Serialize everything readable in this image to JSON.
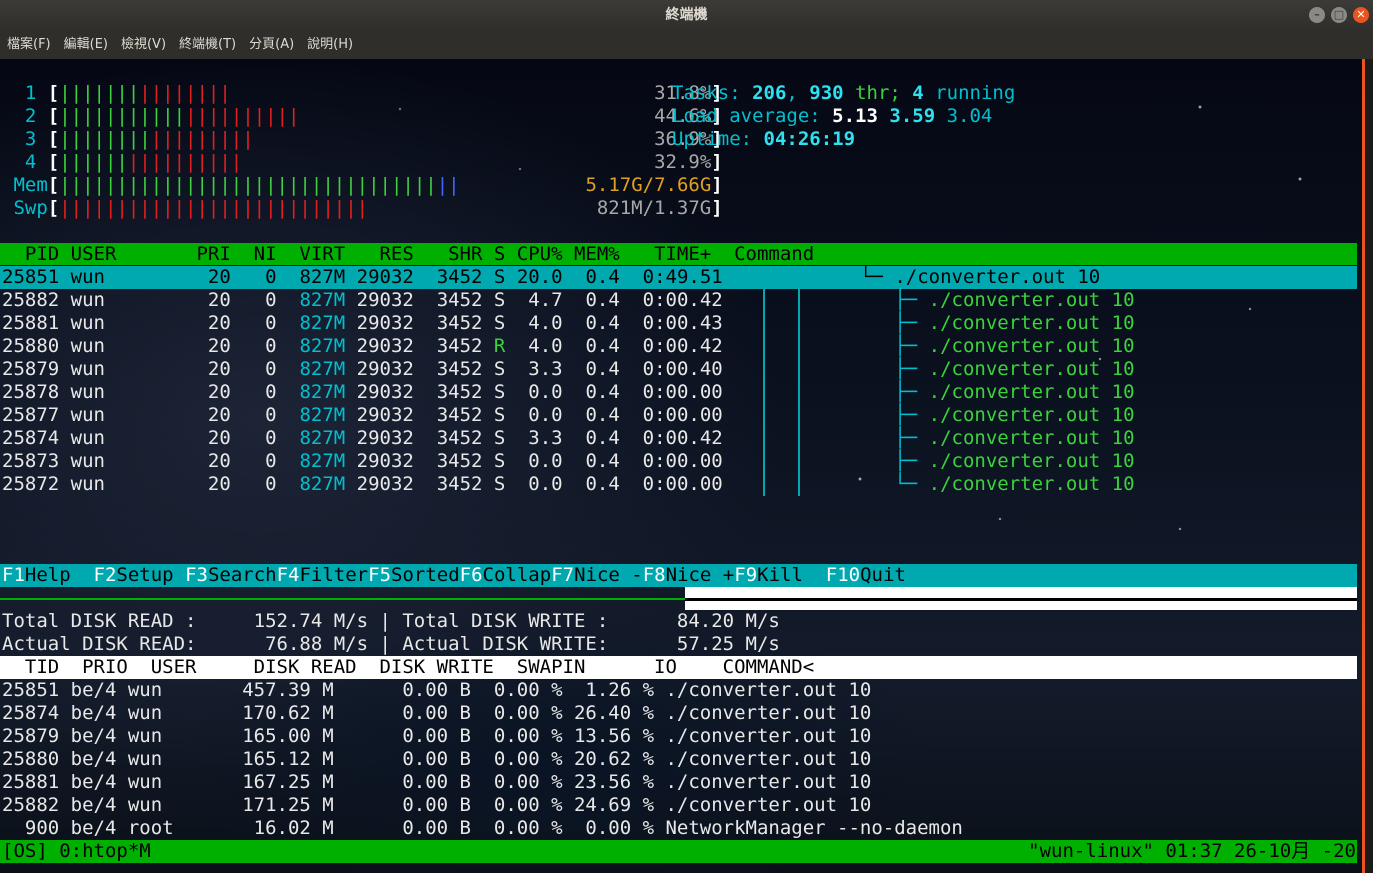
{
  "window": {
    "title": "終端機"
  },
  "menubar": [
    "檔案(F)",
    "編輯(E)",
    "檢視(V)",
    "終端機(T)",
    "分頁(A)",
    "說明(H)"
  ],
  "meters": {
    "cpu": [
      {
        "id": "1",
        "green": 7,
        "red": 8,
        "percent": "31.8%"
      },
      {
        "id": "2",
        "green": 11,
        "red": 10,
        "percent": "44.6%"
      },
      {
        "id": "3",
        "green": 8,
        "red": 9,
        "percent": "36.9%"
      },
      {
        "id": "4",
        "green": 6,
        "red": 10,
        "percent": "32.9%"
      }
    ],
    "mem": {
      "label": "Mem",
      "green": 33,
      "blue": 2,
      "text": "5.17G/7.66G"
    },
    "swp": {
      "label": "Swp",
      "red": 27,
      "text": "821M/1.37G"
    }
  },
  "summary": {
    "tasks_label": "Tasks: ",
    "tasks": "206",
    "threads": "930",
    "thr_label": "thr; ",
    "running": "4",
    "running_label": "running",
    "load_label": "Load average: ",
    "load1": "5.13",
    "load5": "3.59",
    "load15": "3.04",
    "uptime_label": "Uptime: ",
    "uptime": "04:26:19"
  },
  "htop_header": "  PID USER       PRI  NI  VIRT   RES   SHR S CPU% MEM%   TIME+  Command",
  "processes": [
    {
      "pid": "25851",
      "user": "wun",
      "pri": "20",
      "ni": "0",
      "virt": "827M",
      "res": "29032",
      "shr": "3452",
      "s": "S",
      "cpu": "20.0",
      "mem": "0.4",
      "time": "0:49.51",
      "tree": "└─",
      "cmd": "./converter.out 10",
      "selected": true
    },
    {
      "pid": "25882",
      "user": "wun",
      "pri": "20",
      "ni": "0",
      "virt": "827M",
      "res": "29032",
      "shr": "3452",
      "s": "S",
      "cpu": "4.7",
      "mem": "0.4",
      "time": "0:00.42",
      "tree": "├─",
      "cmd": "./converter.out 10"
    },
    {
      "pid": "25881",
      "user": "wun",
      "pri": "20",
      "ni": "0",
      "virt": "827M",
      "res": "29032",
      "shr": "3452",
      "s": "S",
      "cpu": "4.0",
      "mem": "0.4",
      "time": "0:00.43",
      "tree": "├─",
      "cmd": "./converter.out 10"
    },
    {
      "pid": "25880",
      "user": "wun",
      "pri": "20",
      "ni": "0",
      "virt": "827M",
      "res": "29032",
      "shr": "3452",
      "s": "R",
      "cpu": "4.0",
      "mem": "0.4",
      "time": "0:00.42",
      "tree": "├─",
      "cmd": "./converter.out 10"
    },
    {
      "pid": "25879",
      "user": "wun",
      "pri": "20",
      "ni": "0",
      "virt": "827M",
      "res": "29032",
      "shr": "3452",
      "s": "S",
      "cpu": "3.3",
      "mem": "0.4",
      "time": "0:00.40",
      "tree": "├─",
      "cmd": "./converter.out 10"
    },
    {
      "pid": "25878",
      "user": "wun",
      "pri": "20",
      "ni": "0",
      "virt": "827M",
      "res": "29032",
      "shr": "3452",
      "s": "S",
      "cpu": "0.0",
      "mem": "0.4",
      "time": "0:00.00",
      "tree": "├─",
      "cmd": "./converter.out 10"
    },
    {
      "pid": "25877",
      "user": "wun",
      "pri": "20",
      "ni": "0",
      "virt": "827M",
      "res": "29032",
      "shr": "3452",
      "s": "S",
      "cpu": "0.0",
      "mem": "0.4",
      "time": "0:00.00",
      "tree": "├─",
      "cmd": "./converter.out 10"
    },
    {
      "pid": "25874",
      "user": "wun",
      "pri": "20",
      "ni": "0",
      "virt": "827M",
      "res": "29032",
      "shr": "3452",
      "s": "S",
      "cpu": "3.3",
      "mem": "0.4",
      "time": "0:00.42",
      "tree": "├─",
      "cmd": "./converter.out 10"
    },
    {
      "pid": "25873",
      "user": "wun",
      "pri": "20",
      "ni": "0",
      "virt": "827M",
      "res": "29032",
      "shr": "3452",
      "s": "S",
      "cpu": "0.0",
      "mem": "0.4",
      "time": "0:00.00",
      "tree": "├─",
      "cmd": "./converter.out 10"
    },
    {
      "pid": "25872",
      "user": "wun",
      "pri": "20",
      "ni": "0",
      "virt": "827M",
      "res": "29032",
      "shr": "3452",
      "s": "S",
      "cpu": "0.0",
      "mem": "0.4",
      "time": "0:00.00",
      "tree": "└─",
      "cmd": "./converter.out 10"
    }
  ],
  "fkeys": [
    {
      "key": "F1",
      "label": "Help  "
    },
    {
      "key": "F2",
      "label": "Setup "
    },
    {
      "key": "F3",
      "label": "Search"
    },
    {
      "key": "F4",
      "label": "Filter"
    },
    {
      "key": "F5",
      "label": "Sorted"
    },
    {
      "key": "F6",
      "label": "Collap"
    },
    {
      "key": "F7",
      "label": "Nice -"
    },
    {
      "key": "F8",
      "label": "Nice +"
    },
    {
      "key": "F9",
      "label": "Kill  "
    },
    {
      "key": "F10",
      "label": "Quit"
    }
  ],
  "iotop": {
    "total_line": "Total DISK READ :     152.74 M/s | Total DISK WRITE :      84.20 M/s",
    "actual_line": "Actual DISK READ:      76.88 M/s | Actual DISK WRITE:      57.25 M/s",
    "header": "  TID  PRIO  USER     DISK READ  DISK WRITE  SWAPIN      IO    COMMAND<",
    "rows": [
      "25851 be/4 wun       457.39 M      0.00 B  0.00 %  1.26 % ./converter.out 10",
      "25874 be/4 wun       170.62 M      0.00 B  0.00 % 26.40 % ./converter.out 10",
      "25879 be/4 wun       165.00 M      0.00 B  0.00 % 13.56 % ./converter.out 10",
      "25880 be/4 wun       165.12 M      0.00 B  0.00 % 20.62 % ./converter.out 10",
      "25881 be/4 wun       167.25 M      0.00 B  0.00 % 23.56 % ./converter.out 10",
      "25882 be/4 wun       171.25 M      0.00 B  0.00 % 24.69 % ./converter.out 10",
      "  900 be/4 root       16.02 M      0.00 B  0.00 %  0.00 % NetworkManager --no-daemon"
    ]
  },
  "tmux": {
    "left": "[OS] 0:htop*M",
    "right": "\"wun-linux\" 01:37 26-10月 -20"
  }
}
